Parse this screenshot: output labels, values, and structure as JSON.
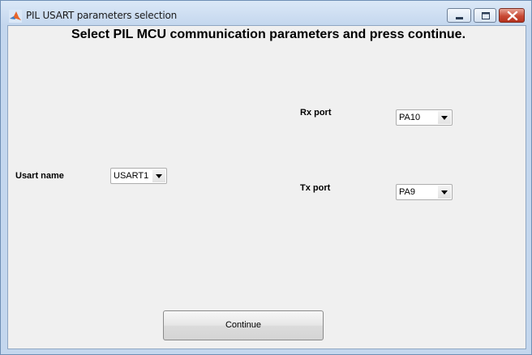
{
  "window": {
    "title": "PIL USART parameters selection",
    "icon": "matlab-icon"
  },
  "heading": "Select PIL MCU communication parameters and press continue.",
  "usart": {
    "label": "Usart name",
    "value": "USART1"
  },
  "rx": {
    "label": "Rx port",
    "value": "PA10"
  },
  "tx": {
    "label": "Tx port",
    "value": "PA9"
  },
  "continue_label": "Continue",
  "colors": {
    "title_bg": "#c4d7ee",
    "client_bg": "#f0f0f0",
    "close_btn": "#c84a35"
  }
}
